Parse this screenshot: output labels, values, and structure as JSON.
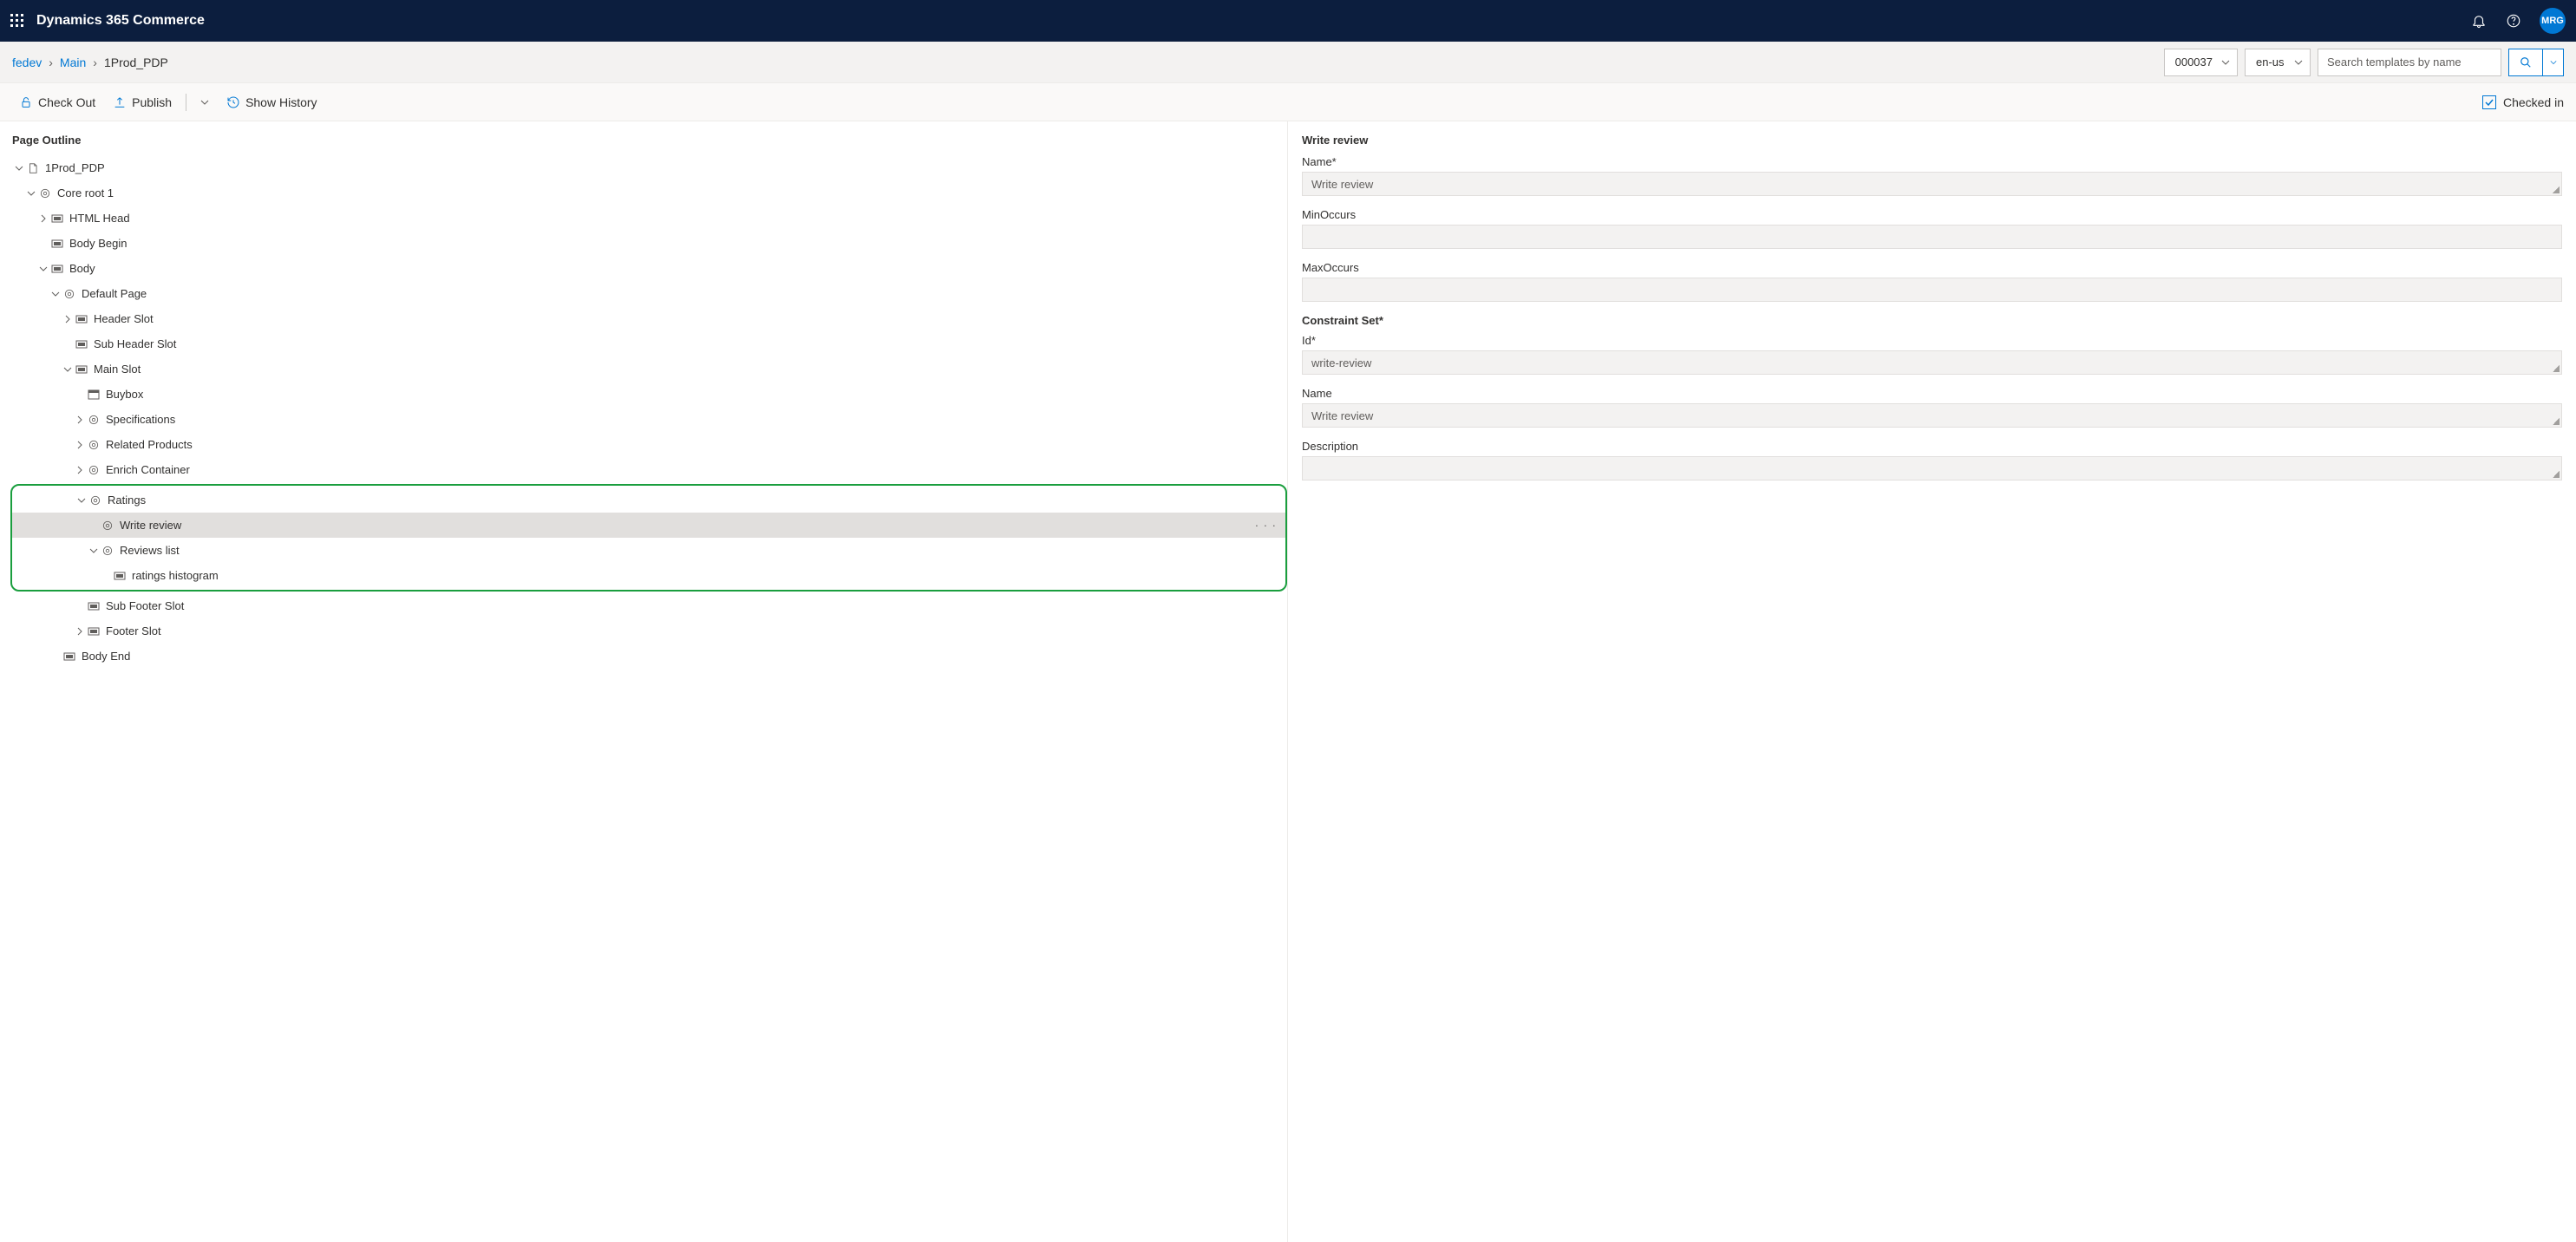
{
  "header": {
    "title": "Dynamics 365 Commerce",
    "avatar": "MRG"
  },
  "breadcrumb": {
    "root": "fedev",
    "mid": "Main",
    "current": "1Prod_PDP",
    "dd1": "000037",
    "dd2": "en-us",
    "search_placeholder": "Search templates by name"
  },
  "commands": {
    "checkout": "Check Out",
    "publish": "Publish",
    "history": "Show History",
    "checked_in": "Checked in"
  },
  "outline": {
    "title": "Page Outline",
    "root": "1Prod_PDP",
    "core": "Core root 1",
    "html_head": "HTML Head",
    "body_begin": "Body Begin",
    "body": "Body",
    "default_page": "Default Page",
    "header_slot": "Header Slot",
    "sub_header_slot": "Sub Header Slot",
    "main_slot": "Main Slot",
    "buybox": "Buybox",
    "specifications": "Specifications",
    "related_products": "Related Products",
    "enrich_container": "Enrich Container",
    "ratings": "Ratings",
    "write_review": "Write review",
    "reviews_list": "Reviews list",
    "ratings_histogram": "ratings histogram",
    "sub_footer_slot": "Sub Footer Slot",
    "footer_slot": "Footer Slot",
    "body_end": "Body End"
  },
  "panel": {
    "title": "Write review",
    "name_label": "Name*",
    "name_value": "Write review",
    "min_label": "MinOccurs",
    "min_value": "",
    "max_label": "MaxOccurs",
    "max_value": "",
    "constraint_set": "Constraint Set*",
    "id_label": "Id*",
    "id_value": "write-review",
    "name2_label": "Name",
    "name2_value": "Write review",
    "desc_label": "Description",
    "desc_value": ""
  }
}
